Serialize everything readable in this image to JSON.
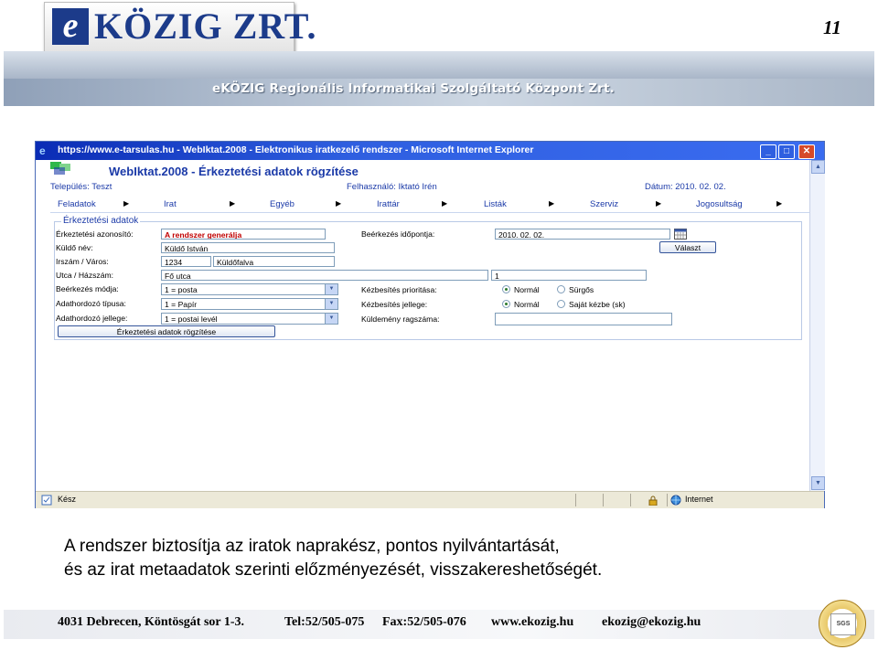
{
  "slide": {
    "page_number": "11",
    "logo": {
      "e": "e",
      "text": "KÖZIG ZRT."
    },
    "org_name": "eKÖZIG Regionális Informatikai Szolgáltató Központ Zrt.",
    "caption_line1": "A rendszer biztosítja az iratok naprakész, pontos nyilvántartását,",
    "caption_line2": "és az irat metaadatok szerinti előzményezését, visszakereshetőségét.",
    "footer": {
      "address": "4031 Debrecen, Köntösgát sor 1-3.",
      "tel": "Tel:52/505-075",
      "fax": "Fax:52/505-076",
      "web": "www.ekozig.hu",
      "email": "ekozig@ekozig.hu"
    },
    "cert_badge": {
      "text": "SGS",
      "icon": "certification-badge-icon"
    }
  },
  "browser": {
    "title": "https://www.e-tarsulas.hu - WebIktat.2008 - Elektronikus iratkezelő rendszer - Microsoft Internet Explorer",
    "status_left": "Kész",
    "status_zone": "Internet",
    "icons": [
      "ie-icon",
      "minimize-icon",
      "maximize-icon",
      "close-icon",
      "page-icon",
      "lock-icon",
      "globe-icon"
    ]
  },
  "app": {
    "title": "WebIktat.2008 - Érkeztetési adatok rögzítése",
    "settlement": "Település: Teszt",
    "user": "Felhasználó: Iktató Irén",
    "date": "Dátum: 2010. 02. 02.",
    "menu": [
      "Feladatok",
      "Irat",
      "Egyéb",
      "Irattár",
      "Listák",
      "Szerviz",
      "Jogosultság"
    ]
  },
  "form": {
    "legend": "Érkeztetési adatok",
    "id_label": "Érkeztetési azonosító:",
    "id_value": "A rendszer generálja",
    "sender_label": "Küldő név:",
    "sender_value": "Küldő István",
    "zip_city_label": "Irszám / Város:",
    "zip_value": "1234",
    "city_value": "Küldőfalva",
    "street_label": "Utca / Házszám:",
    "street_value": "Fő utca",
    "house_value": "1",
    "method_label": "Beérkezés módja:",
    "method_value": "1 = posta",
    "media_label": "Adathordozó típusa:",
    "media_value": "1 = Papír",
    "media_nature_label": "Adathordozó jellege:",
    "media_nature_value": "1 = postai levél",
    "arrival_label": "Beérkezés időpontja:",
    "arrival_value": "2010. 02. 02.",
    "select_button": "Választ",
    "priority_label": "Kézbesítés prioritása:",
    "priority_options": [
      "Normál",
      "Sürgős"
    ],
    "priority_selected": "Normál",
    "nature_label": "Kézbesítés jellege:",
    "nature_options": [
      "Normál",
      "Saját kézbe (sk)"
    ],
    "nature_selected": "Normál",
    "tracking_label": "Küldemény ragszáma:",
    "tracking_value": "",
    "submit_button": "Érkeztetési adatok rögzítése"
  }
}
